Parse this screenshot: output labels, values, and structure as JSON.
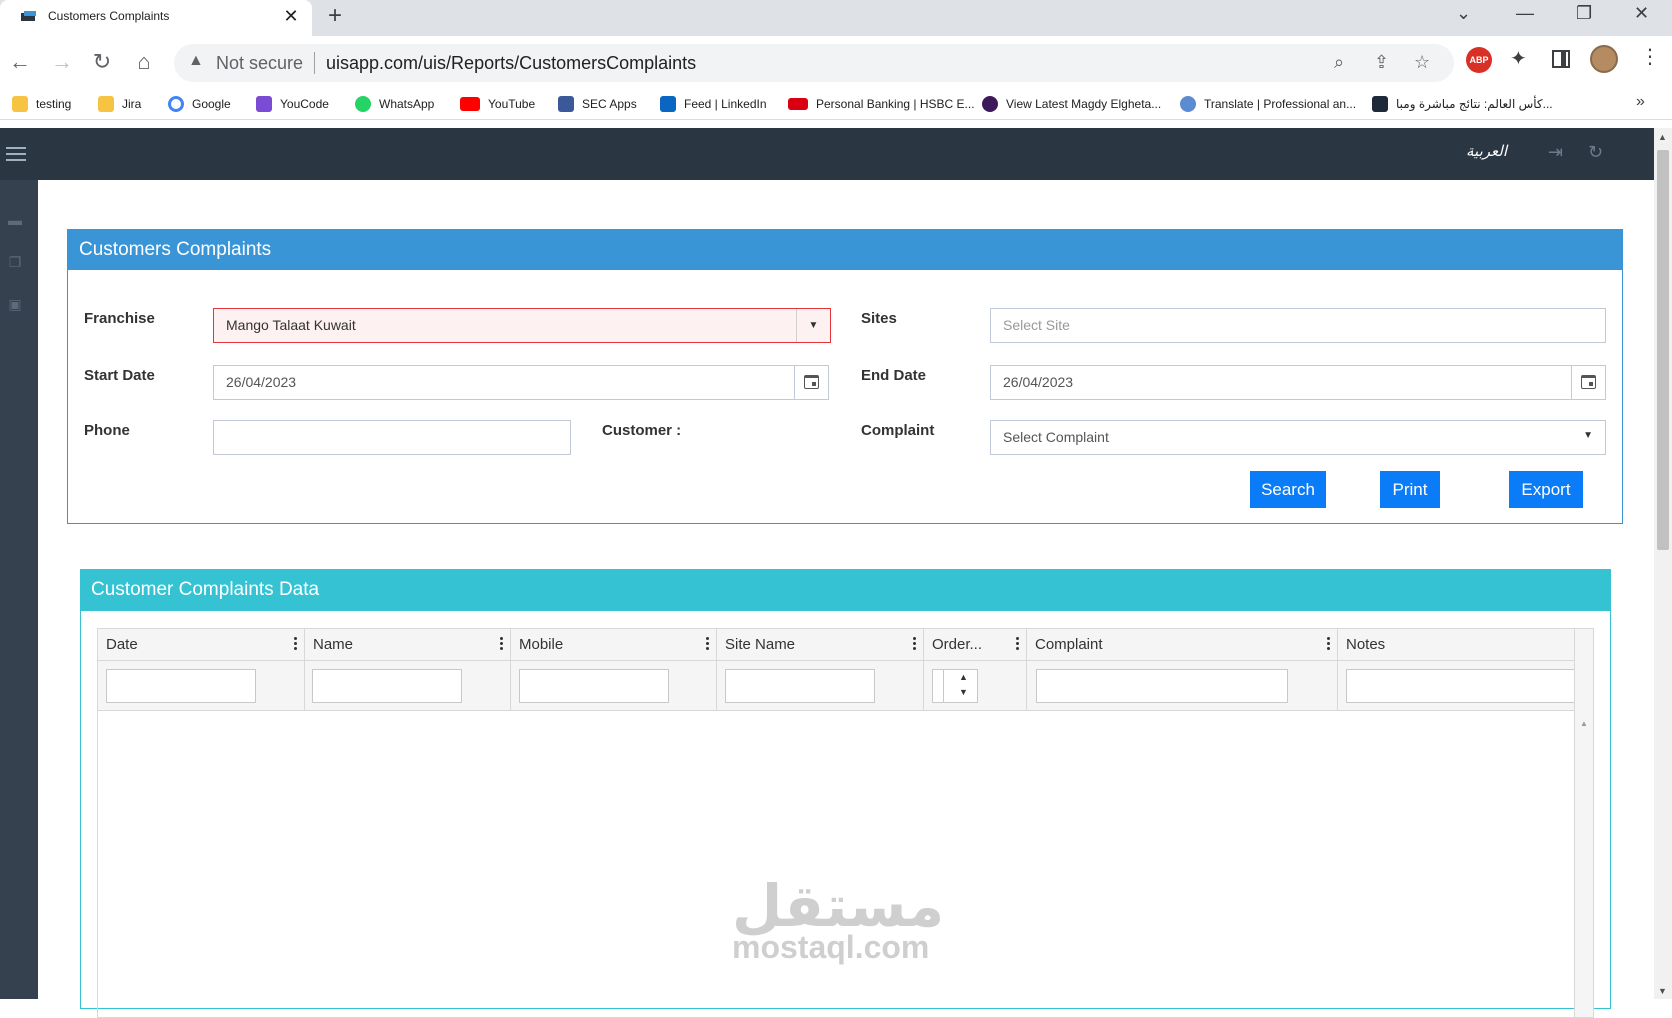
{
  "browser": {
    "tab_title": "Customers Complaints",
    "tab_close": "✕",
    "new_tab": "+",
    "security_label": "Not secure",
    "url": "uisapp.com/uis/Reports/CustomersComplaints",
    "bookmarks": [
      {
        "label": "testing",
        "icon": "folder-icon",
        "color": "#f6c343"
      },
      {
        "label": "Jira",
        "icon": "folder-icon",
        "color": "#f6c343"
      },
      {
        "label": "Google",
        "icon": "google-icon",
        "color": "#4285f4"
      },
      {
        "label": "YouCode",
        "icon": "youcode-icon",
        "color": "#7b4bd6"
      },
      {
        "label": "WhatsApp",
        "icon": "whatsapp-icon",
        "color": "#25d366"
      },
      {
        "label": "YouTube",
        "icon": "youtube-icon",
        "color": "#ff0000"
      },
      {
        "label": "SEC Apps",
        "icon": "sec-apps-icon",
        "color": "#3b5998"
      },
      {
        "label": "Feed | LinkedIn",
        "icon": "linkedin-icon",
        "color": "#0a66c2"
      },
      {
        "label": "Personal Banking | HSBC E...",
        "icon": "hsbc-icon",
        "color": "#db0011"
      },
      {
        "label": "View Latest Magdy Elgheta...",
        "icon": "premier-league-icon",
        "color": "#3d195b"
      },
      {
        "label": "Translate | Professional an...",
        "icon": "globe-icon",
        "color": "#5b8bd0"
      },
      {
        "label": "كأس العالم: نتائج مباشرة ومبا...",
        "icon": "livescore-icon",
        "color": "#1e2a3a"
      }
    ],
    "bookmarks_more": "»"
  },
  "app": {
    "language_toggle": "العربية"
  },
  "filter_panel": {
    "title": "Customers Complaints",
    "franchise_label": "Franchise",
    "franchise_value": "Mango Talaat Kuwait",
    "sites_label": "Sites",
    "sites_placeholder": "Select Site",
    "start_date_label": "Start Date",
    "start_date_value": "26/04/2023",
    "end_date_label": "End Date",
    "end_date_value": "26/04/2023",
    "phone_label": "Phone",
    "phone_value": "",
    "customer_label": "Customer :",
    "complaint_label": "Complaint",
    "complaint_placeholder": "Select Complaint",
    "search_button": "Search",
    "print_button": "Print",
    "export_button": "Export"
  },
  "data_panel": {
    "title": "Customer Complaints Data",
    "columns": [
      "Date",
      "Name",
      "Mobile",
      "Site Name",
      "Order...",
      "Complaint",
      "Notes"
    ]
  },
  "watermark": {
    "arabic": "مستقل",
    "latin": "mostaql.com"
  }
}
